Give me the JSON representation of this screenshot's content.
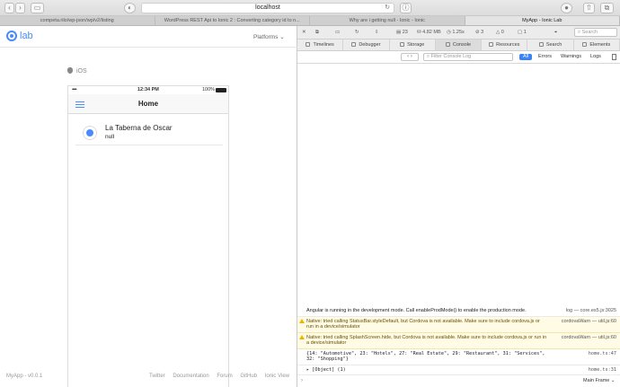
{
  "browser": {
    "address": "localhost",
    "tabs": [
      {
        "label": "competa.rilo/wp-json/wp/v2/listing",
        "active": false
      },
      {
        "label": "WordPress REST Api to Ionic 2 : Converting category id to n...",
        "active": false
      },
      {
        "label": "Why are i getting null - Ionic - Ionic",
        "active": false
      },
      {
        "label": "MyApp - Ionic Lab",
        "active": true
      }
    ]
  },
  "lab": {
    "logo_text": "lab",
    "platforms_label": "Platforms",
    "platform_name": "iOS",
    "version": "MyApp - v0.0.1",
    "footer_links": [
      "Twitter",
      "Documentation",
      "Forum",
      "GitHub",
      "Ionic View"
    ]
  },
  "phone": {
    "time": "12:34 PM",
    "battery": "100%",
    "nav_title": "Home",
    "item": {
      "title": "La Taberna de Oscar",
      "subtitle": "null"
    }
  },
  "inspector": {
    "stats": {
      "resources": "23",
      "size": "4.82 MB",
      "time": "1.25s",
      "errors": "3",
      "warnings": "0",
      "logs": "1"
    },
    "search_placeholder": "Search",
    "tabs": [
      "Timelines",
      "Debugger",
      "Storage",
      "Console",
      "Resources",
      "Search",
      "Elements"
    ],
    "filter_placeholder": "Filter Console Log",
    "levels": [
      "All",
      "Errors",
      "Warnings",
      "Logs"
    ],
    "console": [
      {
        "type": "log",
        "text": "Angular is running in the development mode. Call enableProdMode() to enable the production mode.",
        "tag": "log",
        "source": "core.es5.js:3025"
      },
      {
        "type": "warn",
        "text": "Native: tried calling StatusBar.styleDefault, but Cordova is not available. Make sure to include cordova.js or run in a device/simulator",
        "tag": "cordovaWarn",
        "source": "util.js:60"
      },
      {
        "type": "warn",
        "text": "Native: tried calling SplashScreen.hide, but Cordova is not available. Make sure to include cordova.js or run in a device/simulator",
        "tag": "cordovaWarn",
        "source": "util.js:60"
      },
      {
        "type": "log",
        "text": "{14: \"Automotive\", 23: \"Hotels\", 27: \"Real Estate\", 29: \"Restaurant\", 31: \"Services\", 32: \"Shopping\"}",
        "tag": "",
        "source": "home.ts:47"
      },
      {
        "type": "log",
        "text": "[Object] (1)",
        "tag": "",
        "source": "home.ts:31"
      }
    ],
    "frame": "Main Frame"
  }
}
